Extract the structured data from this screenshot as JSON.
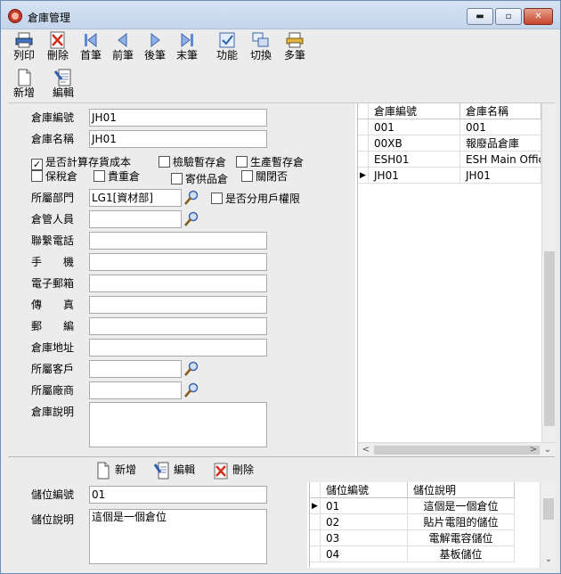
{
  "window": {
    "title": "倉庫管理",
    "min_glyph": "▬",
    "max_glyph": "▫",
    "close_glyph": "✕"
  },
  "toolbar": {
    "print": "列印",
    "delete": "刪除",
    "first": "首筆",
    "prev": "前筆",
    "next": "後筆",
    "last": "末筆",
    "function": "功能",
    "switch": "切換",
    "multi": "多筆",
    "new": "新增",
    "edit": "編輯"
  },
  "form": {
    "code_label": "倉庫編號",
    "code_value": "JH01",
    "name_label": "倉庫名稱",
    "name_value": "JH01",
    "chk_cost": "是否計算存貨成本",
    "chk_cost_mark": "✓",
    "chk_inspect": "檢驗暫存倉",
    "chk_production": "生產暫存倉",
    "chk_bonded": "保稅倉",
    "chk_valuable": "貴重倉",
    "chk_consign": "寄供品倉",
    "chk_closed": "關閉否",
    "dept_label": "所屬部門",
    "dept_value": "LG1[資材部]",
    "chk_user_perm": "是否分用戶權限",
    "keeper_label": "倉管人員",
    "keeper_value": "",
    "phone_label": "聯繫電話",
    "phone_value": "",
    "mobile_label": "手　　機",
    "mobile_value": "",
    "email_label": "電子郵箱",
    "email_value": "",
    "fax_label": "傳　　真",
    "fax_value": "",
    "zip_label": "郵　　編",
    "zip_value": "",
    "address_label": "倉庫地址",
    "address_value": "",
    "customer_label": "所屬客戶",
    "customer_value": "",
    "vendor_label": "所屬廠商",
    "vendor_value": "",
    "desc_label": "倉庫說明",
    "desc_value": ""
  },
  "warehouse_grid": {
    "headers": [
      "倉庫編號",
      "倉庫名稱"
    ],
    "rows": [
      [
        "001",
        "001"
      ],
      [
        "00XB",
        "報廢品倉庫"
      ],
      [
        "ESH01",
        "ESH Main Office"
      ],
      [
        "JH01",
        "JH01"
      ]
    ],
    "current_row_marker": "▶"
  },
  "location_bar": {
    "new": "新增",
    "edit": "編輯",
    "delete": "刪除"
  },
  "location_form": {
    "code_label": "儲位編號",
    "code_value": "01",
    "desc_label": "儲位說明",
    "desc_value": "這個是一個倉位"
  },
  "location_grid": {
    "headers": [
      "儲位編號",
      "儲位說明"
    ],
    "rows": [
      [
        "01",
        "這個是一個倉位"
      ],
      [
        "02",
        "貼片電阻的儲位"
      ],
      [
        "03",
        "電解電容儲位"
      ],
      [
        "04",
        "基板儲位"
      ]
    ],
    "current_row_marker": "▶"
  },
  "colors": {
    "titlebar": "#c8d8ee",
    "close": "#c7432a",
    "panel": "#ececec",
    "accent_blue": "#2f5fb0"
  }
}
